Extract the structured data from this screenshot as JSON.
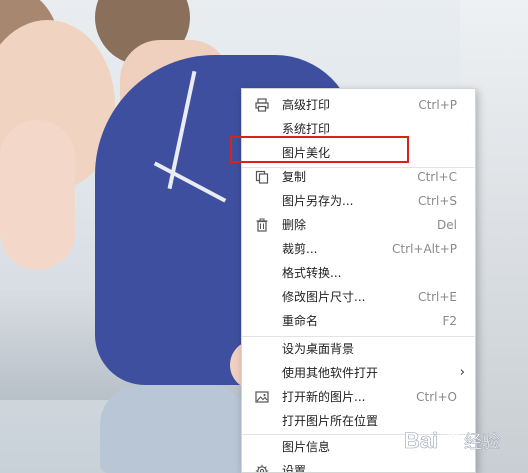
{
  "menu": {
    "items": [
      {
        "icon": "printer-icon",
        "label": "高级打印",
        "shortcut": "Ctrl+P"
      },
      {
        "icon": "",
        "label": "系统打印",
        "shortcut": ""
      },
      {
        "icon": "",
        "label": "图片美化",
        "shortcut": ""
      },
      {
        "icon": "copy-icon",
        "label": "复制",
        "shortcut": "Ctrl+C"
      },
      {
        "icon": "",
        "label": "图片另存为...",
        "shortcut": "Ctrl+S"
      },
      {
        "icon": "trash-icon",
        "label": "删除",
        "shortcut": "Del"
      },
      {
        "icon": "",
        "label": "裁剪...",
        "shortcut": "Ctrl+Alt+P"
      },
      {
        "icon": "",
        "label": "格式转换...",
        "shortcut": ""
      },
      {
        "icon": "",
        "label": "修改图片尺寸...",
        "shortcut": "Ctrl+E"
      },
      {
        "icon": "",
        "label": "重命名",
        "shortcut": "F2"
      },
      {
        "icon": "",
        "label": "设为桌面背景",
        "shortcut": ""
      },
      {
        "icon": "",
        "label": "使用其他软件打开",
        "shortcut": ""
      },
      {
        "icon": "image-icon",
        "label": "打开新的图片...",
        "shortcut": "Ctrl+O"
      },
      {
        "icon": "",
        "label": "打开图片所在位置",
        "shortcut": ""
      },
      {
        "icon": "",
        "label": "图片信息",
        "shortcut": ""
      },
      {
        "icon": "gear-icon",
        "label": "设置",
        "shortcut": ""
      }
    ],
    "submenu_arrow": "›",
    "highlight_color": "#d8231a"
  },
  "watermark": {
    "text": "Bai",
    "suffix": "经验",
    "accent": "#2c6fd1"
  }
}
